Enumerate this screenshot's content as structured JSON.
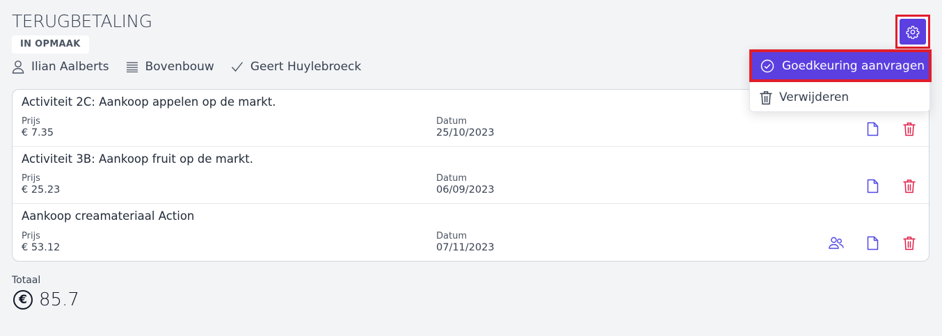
{
  "header": {
    "title": "TERUGBETALING",
    "status": "IN OPMAAK",
    "person": "Ilian Aalberts",
    "group": "Bovenbouw",
    "approver": "Geert Huylebroeck"
  },
  "labels": {
    "price": "Prijs",
    "date": "Datum",
    "total": "Totaal"
  },
  "items": [
    {
      "title": "Activiteit 2C: Aankoop appelen op de markt.",
      "price": "€ 7.35",
      "date": "25/10/2023"
    },
    {
      "title": "Activiteit 3B: Aankoop fruit op de markt.",
      "price": "€ 25.23",
      "date": "06/09/2023"
    },
    {
      "title": "Aankoop creamateriaal Action",
      "price": "€ 53.12",
      "date": "07/11/2023"
    }
  ],
  "total": {
    "value": "85.7",
    "currency_symbol": "€"
  },
  "menu": {
    "approve_label": "Goedkeuring aanvragen",
    "delete_label": "Verwijderen"
  },
  "icons": {
    "settings": "gear-icon",
    "user": "user-icon",
    "group": "list-icon",
    "approver": "check-icon",
    "document": "document-icon",
    "delete": "trash-icon",
    "participants": "users-icon",
    "currency": "euro-circle-icon"
  },
  "colors": {
    "accent": "#5b3fe0",
    "danger": "#e11d48",
    "highlight": "#e11d2b",
    "background": "#f3f4f6"
  }
}
